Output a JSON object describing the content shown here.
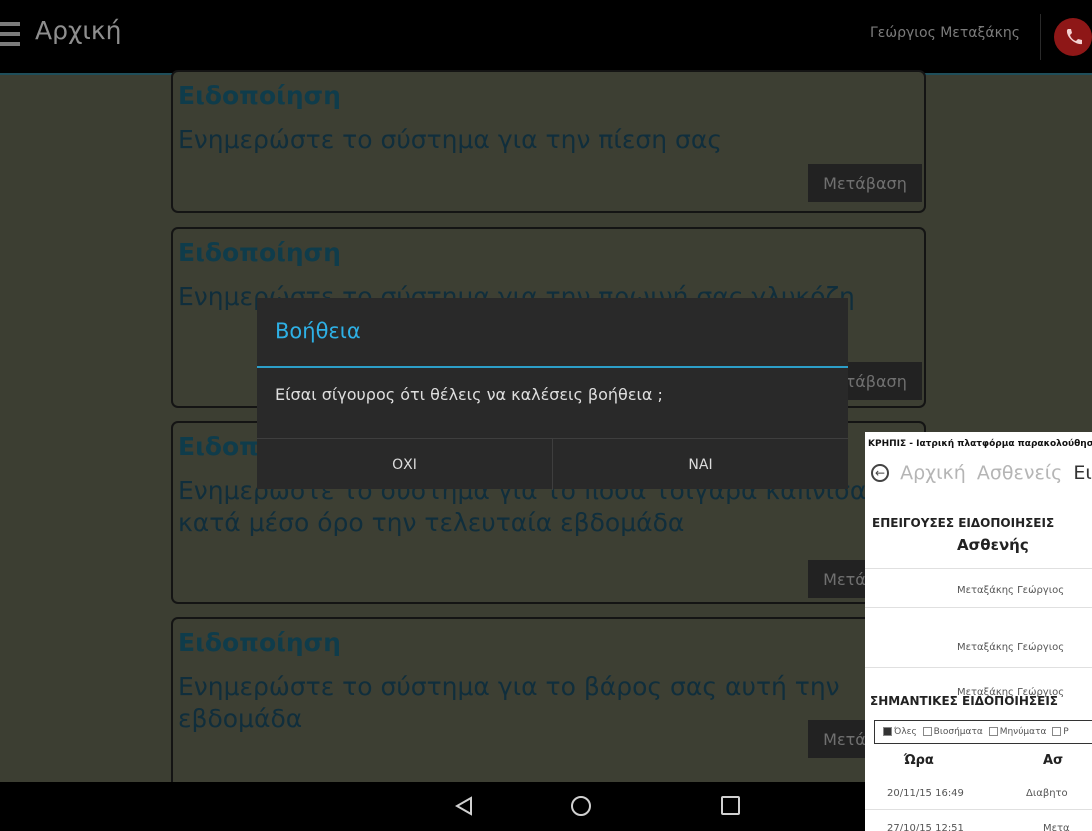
{
  "topbar": {
    "title": "Αρχική",
    "user_name": "Γεώργιος Μεταξάκης",
    "menu_icon": "hamburger-menu-icon",
    "call_icon": "phone-icon"
  },
  "cards": [
    {
      "title": "Ειδοποίηση",
      "text": "Ενημερώστε το σύστημα για την πίεση σας",
      "button": "Μετάβαση"
    },
    {
      "title": "Ειδοποίηση",
      "text": "Ενημερώστε το σύστημα για την πρωινή σας γλυκόζη",
      "button": "Μετάβαση"
    },
    {
      "title": "Ειδοποίηση",
      "text": "Ενημερώστε το σύστημα για το πόσα τσιγάρα καπνίσατε κατά μέσο όρο την τελευταία εβδομάδα",
      "button": "Μετάβαση"
    },
    {
      "title": "Ειδοποίηση",
      "text": "Ενημερώστε το σύστημα για το βάρος σας αυτή την εβδομάδα",
      "button": "Μετάβαση"
    }
  ],
  "dialog": {
    "title": "Βοήθεια",
    "message": "Είσαι σίγουρος ότι θέλεις να καλέσεις βοήθεια ;",
    "no_label": "ΟΧΙ",
    "yes_label": "ΝΑΙ"
  },
  "overlay": {
    "header": "ΚΡΗΠΙΣ - Ιατρική πλατφόρμα παρακολούθησης",
    "nav_tabs": [
      "Αρχική",
      "Ασθενείς",
      "Ει"
    ],
    "urgent_heading": "ΕΠΕΙΓΟΥΣΕΣ ΕΙΔΟΠΟΙΗΣΕΙΣ",
    "patient_heading": "Ασθενής",
    "patients": [
      "Μεταξάκης Γεώργιος",
      "Μεταξάκης Γεώργιος",
      "Μεταξάκης Γεώργιος"
    ],
    "important_heading": "ΣΗΜΑΝΤΙΚΕΣ ΕΙΔΟΠΟΙΗΣΕΙΣ",
    "filters": [
      "Όλες",
      "Βιοσήματα",
      "Μηνύματα",
      "Ρ"
    ],
    "col_time": "Ώρα",
    "col_second": "Ασ",
    "rows": [
      {
        "time": "20/11/15 16:49",
        "value": "Διαβητο"
      },
      {
        "time": "27/10/15 12:51",
        "value": "Μετα"
      }
    ]
  },
  "navbar": {
    "back_icon": "back-triangle-icon",
    "home_icon": "home-circle-icon",
    "recent_icon": "recent-apps-icon"
  }
}
